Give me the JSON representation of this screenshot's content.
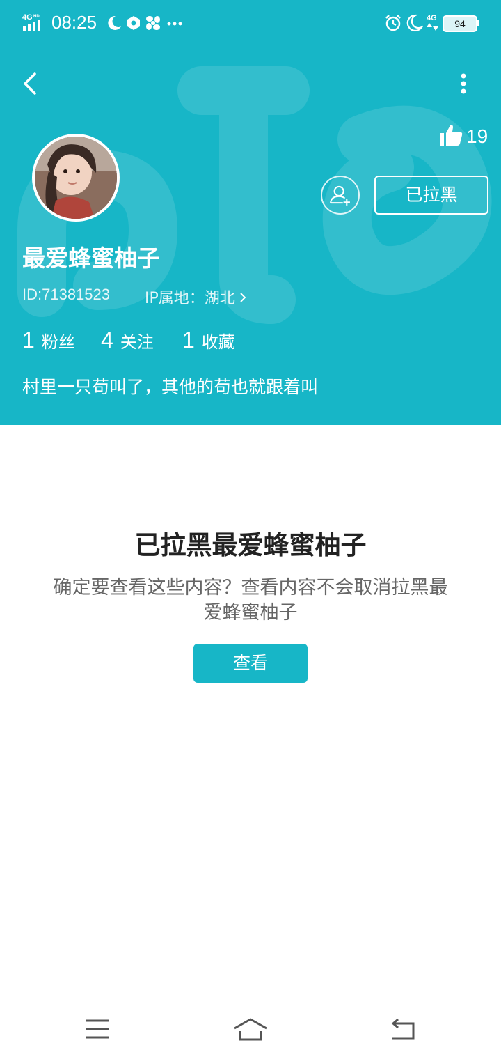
{
  "status_bar": {
    "network_label": "4G",
    "network_hd": "HD",
    "time": "08:25",
    "network_right": "4G",
    "battery": "94"
  },
  "profile": {
    "like_count": "19",
    "blocked_label": "已拉黑",
    "username": "最爱蜂蜜柚子",
    "id_text": "ID:71381523",
    "ip_text": "IP属地：湖北",
    "stats": [
      {
        "num": "1",
        "label": "粉丝"
      },
      {
        "num": "4",
        "label": "关注"
      },
      {
        "num": "1",
        "label": "收藏"
      }
    ],
    "bio": "村里一只苟叫了，其他的苟也就跟着叫"
  },
  "block_notice": {
    "title": "已拉黑最爱蜂蜜柚子",
    "description": "确定要查看这些内容？查看内容不会取消拉黑最爱蜂蜜柚子",
    "button_label": "查看"
  },
  "colors": {
    "accent": "#17b6c7",
    "title_text": "#222222",
    "desc_text": "#666666"
  },
  "icons": [
    "back-arrow-icon",
    "more-vertical-icon",
    "thumbs-up-icon",
    "add-user-icon",
    "chevron-right-icon",
    "menu-icon",
    "home-icon",
    "back-icon"
  ]
}
